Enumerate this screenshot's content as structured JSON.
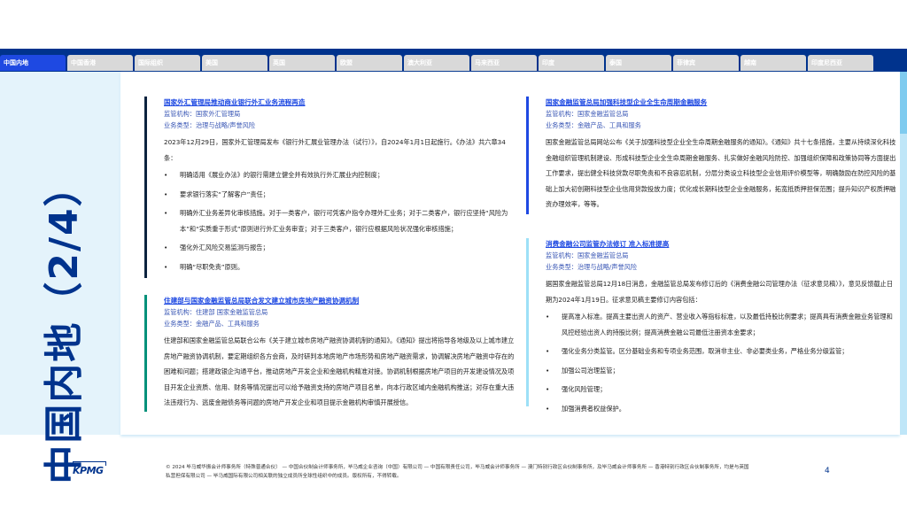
{
  "tabs": [
    "中国内地",
    "中国香港",
    "国际组织",
    "美国",
    "英国",
    "欧盟",
    "澳大利亚",
    "马来西亚",
    "印度",
    "泰国",
    "菲律宾",
    "越南",
    "印度尼西亚"
  ],
  "page_title": "中国内地（2/4）",
  "sections": [
    {
      "title": "国家外汇管理局推动商业银行外汇业务流程再造",
      "regulator": "监管机构：国家外汇管理局",
      "type": "业务类型：治理与战略/声誉风险",
      "body": "2023年12月29日，国家外汇管理局发布《银行外汇展业管理办法（试行）》，自2024年1月1日起施行。《办法》共六章34条：",
      "bullets": [
        "明确适用《展业办法》的银行需建立健全并有效执行外汇展业内控制度；",
        "要求银行落实“了解客户”责任；",
        "明确外汇业务差异化审核措施。对于一类客户，银行可凭客户指令办理外汇业务；对于二类客户，银行应坚持“风险为本”和“实质重于形式”原则进行外汇业务审查；对于三类客户，银行应根据风险状况强化审核措施；",
        "强化外汇风险交易监测与报告；",
        "明确“尽职免责”原则。"
      ]
    },
    {
      "title": "住建部与国家金融监管总局联合发文建立城市房地产融资协调机制",
      "regulator": "监管机构：住建部 国家金融监管总局",
      "type": "业务类型：金融产品、工具和服务",
      "body": "住建部和国家金融监管总局联合公布《关于建立城市房地产融资协调机制的通知》。《通知》提出将指导各地级及以上城市建立房地产融资协调机制，要定期组织各方会商，及时研判本地房地产市场形势和房地产融资需求，协调解决房地产融资中存在的困难和问题；搭建政银企沟通平台，推动房地产开发企业和金融机构精准对接。协调机制根据房地产项目的开发建设情况及项目开发企业资质、信用、财务等情况提出可以给予融资支持的房地产项目名单，向本行政区域内金融机构推送；对存在重大违法违规行为、逃废金融债务等问题的房地产开发企业和项目提示金融机构审慎开展授信。",
      "bullets": []
    },
    {
      "title": "国家金融监管总局加强科技型企业全生命周期金融服务",
      "regulator": "监管机构：国家金融监管总局",
      "type": "业务类型：金融产品、工具和服务",
      "body": "国家金融监管总局网站公布《关于加强科技型企业全生命周期金融服务的通知》。《通知》共十七条措施，主要从持续深化科技金融组织管理机制建设、形成科技型企业全生命周期金融服务、扎实做好金融风险防控、加强组织保障和政策协同等方面提出工作要求，提出健全科技贷款尽职免责和不良容忍机制，分层分类设立科技型企业信用评价模型等，明确鼓励在防控风险的基础上加大初创期科技型企业信用贷款投放力度；优化成长期科技型企业金融服务，拓宽抵质押担保范围；提升知识产权质押融资办理效率，等等。",
      "bullets": []
    },
    {
      "title": "消费金融公司监管办法修订 准入标准提高",
      "regulator": "监管机构：国家金融监管总局",
      "type": "业务类型：治理与战略/声誉风险",
      "body": "据国家金融监管总局12月18日消息，金融监管总局发布修订后的《消费金融公司管理办法（征求意见稿）》，意见反馈截止日期为2024年1月19日。征求意见稿主要修订内容包括：",
      "bullets": [
        "提高准入标准。提高主要出资人的资产、营业收入等指标标准，以及最低持股比例要求；提高具有消费金融业务管理和风控经验出资人的持股比例；提高消费金融公司最低注册资本金要求；",
        "强化业务分类监管。区分基础业务和专项业务范围，取消非主业、非必要类业务，严格业务分级监管；",
        "加强公司治理监管；",
        "强化风险管理；",
        "加强消费者权益保护。"
      ]
    }
  ],
  "footer": {
    "logo": "KPMG",
    "text": "© 2024 毕马威华振会计师事务所（特殊普通合伙） — 中国合伙制会计师事务所，毕马威企业咨询（中国）有限公司 — 中国有限责任公司，毕马威会计师事务所 — 澳门特别行政区合伙制事务所，及毕马威会计师事务所 — 香港特别行政区合伙制事务所，均是与英国私营担保有限公司 — 毕马威国际有限公司相关联的独立成员所全球性组织中的成员。版权所有，不得转载。",
    "page": "4"
  },
  "colors": {
    "navy": "#00338d",
    "blue": "#1e49e2",
    "teal": "#00917a",
    "dark": "#0c233f",
    "light": "#9de0f7"
  }
}
